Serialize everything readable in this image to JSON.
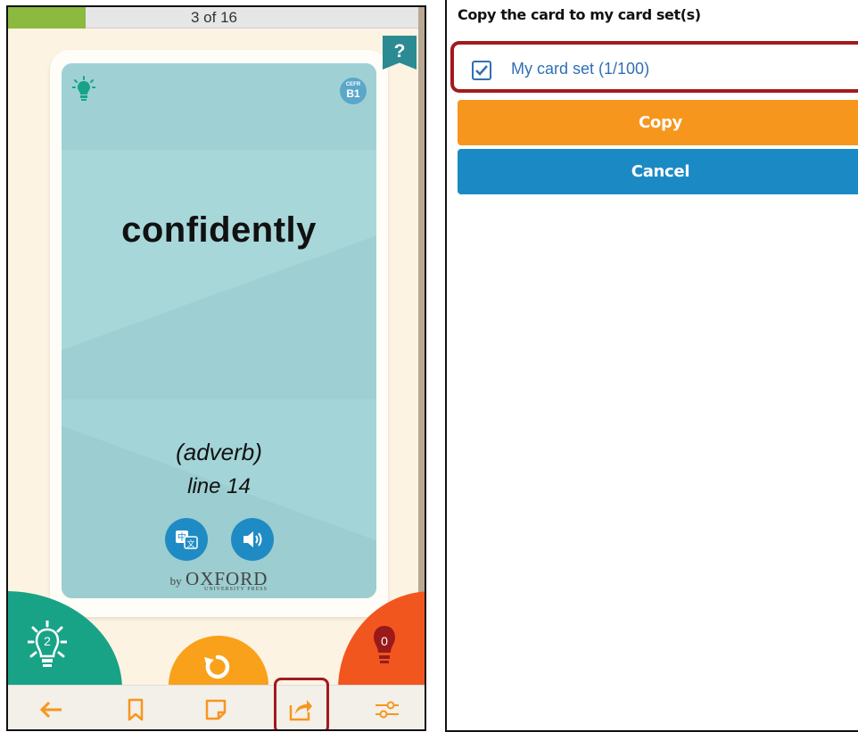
{
  "progress": {
    "text": "3 of 16",
    "fraction": 0.1875
  },
  "help": {
    "label": "?"
  },
  "card": {
    "cefr_caption": "CEFR",
    "cefr_level": "B1",
    "word": "confidently",
    "part_of_speech": "(adverb)",
    "line_ref": "line 14",
    "publisher_by": "by",
    "publisher_name": "OXFORD",
    "publisher_sub": "UNIVERSITY PRESS"
  },
  "counters": {
    "known": "2",
    "unknown": "0"
  },
  "toolbar": {
    "items": [
      "back-arrow-icon",
      "bookmark-icon",
      "note-icon",
      "share-icon",
      "settings-sliders-icon"
    ]
  },
  "dialog": {
    "title": "Copy the card to my card set(s)",
    "set_option": {
      "label": "My card set (1/100)",
      "checked": true
    },
    "copy_label": "Copy",
    "cancel_label": "Cancel"
  },
  "colors": {
    "progress": "#8cb93f",
    "card": "#a5d5d8",
    "known": "#18a386",
    "unknown": "#f2561f",
    "flip": "#f9a11b",
    "copy": "#f7961d",
    "cancel": "#1b8ac4",
    "highlight": "#a21a1e"
  }
}
